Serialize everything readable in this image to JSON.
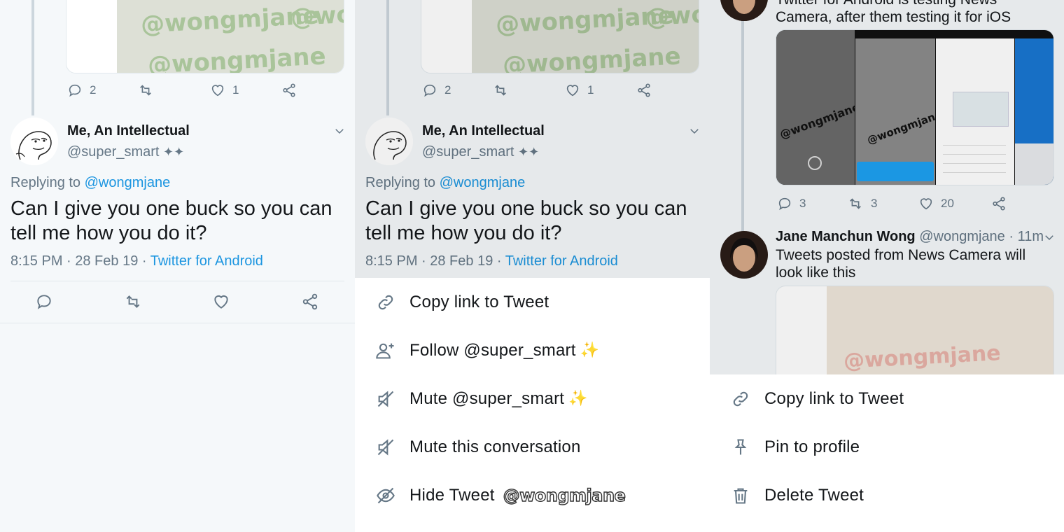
{
  "panel1": {
    "parent_stats": {
      "replies": "2",
      "likes": "1"
    },
    "watermark": "@wongmjane",
    "watermark_short": "@wo",
    "tweet": {
      "name": "Me, An Intellectual",
      "handle": "@super_smart",
      "handle_emoji": "👣",
      "replying_prefix": "Replying to",
      "replying_to": "@wongmjane",
      "text": "Can I give you one buck so you can tell me how you do it?",
      "time": "8:15 PM · 28 Feb 19 ·",
      "source": "Twitter for Android"
    }
  },
  "panel2": {
    "parent_stats": {
      "replies": "2",
      "likes": "1"
    },
    "tweet": {
      "name": "Me, An Intellectual",
      "handle": "@super_smart",
      "replying_prefix": "Replying to",
      "replying_to": "@wongmjane",
      "text": "Can I give you one buck so you can tell me how you do it?",
      "time": "8:15 PM · 28 Feb 19 ·",
      "source": "Twitter for Android"
    },
    "menu": [
      {
        "label": "Copy link to Tweet",
        "icon": "link-icon"
      },
      {
        "label": "Follow @super_smart",
        "icon": "follow-user-icon",
        "suffix": "✨"
      },
      {
        "label": "Mute @super_smart",
        "icon": "mute-icon",
        "suffix": "✨"
      },
      {
        "label": "Mute this conversation",
        "icon": "mute-icon"
      },
      {
        "label": "Hide Tweet",
        "icon": "hide-icon",
        "badge": "@wongmjane"
      }
    ]
  },
  "panel3": {
    "top_text": "Twitter for Android is testing News Camera, after them testing it for iOS",
    "stats": {
      "replies": "3",
      "retweets": "3",
      "likes": "20"
    },
    "tweet2": {
      "name": "Jane Manchun Wong",
      "handle": "@wongmjane · 11m",
      "text": "Tweets posted from News Camera will look like this"
    },
    "watermark": "@wongmjane",
    "menu": [
      {
        "label": "Copy link to Tweet",
        "icon": "link-icon"
      },
      {
        "label": "Pin to profile",
        "icon": "pin-icon"
      },
      {
        "label": "Delete Tweet",
        "icon": "trash-icon"
      }
    ]
  }
}
